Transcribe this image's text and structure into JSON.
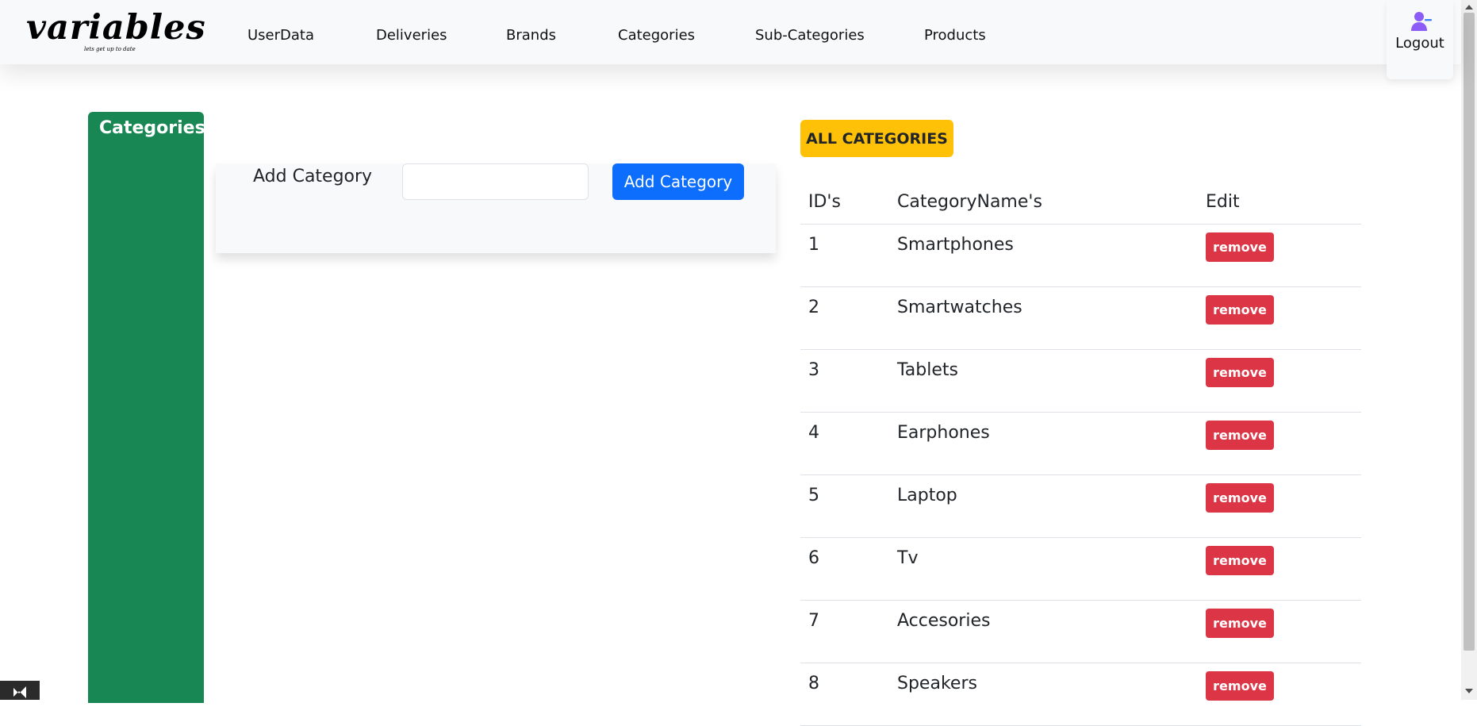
{
  "brand": {
    "name": "variables",
    "tagline": "lets get up to date"
  },
  "nav": {
    "links": [
      "UserData",
      "Deliveries",
      "Brands",
      "Categories",
      "Sub-Categories",
      "Products"
    ],
    "logout": "Logout"
  },
  "sidebar": {
    "title": "Categories"
  },
  "form": {
    "label": "Add Category",
    "input_value": "",
    "input_placeholder": "",
    "button": "Add Category"
  },
  "all_button": "ALL CATEGORIES",
  "table": {
    "headers": [
      "ID's",
      "CategoryName's",
      "Edit"
    ],
    "remove_label": "remove",
    "rows": [
      {
        "id": "1",
        "name": "Smartphones"
      },
      {
        "id": "2",
        "name": "Smartwatches"
      },
      {
        "id": "3",
        "name": "Tablets"
      },
      {
        "id": "4",
        "name": "Earphones"
      },
      {
        "id": "5",
        "name": "Laptop"
      },
      {
        "id": "6",
        "name": "Tv"
      },
      {
        "id": "7",
        "name": "Accesories"
      },
      {
        "id": "8",
        "name": "Speakers"
      }
    ]
  },
  "colors": {
    "sidebar": "#198754",
    "primary_button": "#0d6efd",
    "warning_button": "#ffc107",
    "danger_button": "#dc3545",
    "navbar": "#f8f9fa"
  }
}
